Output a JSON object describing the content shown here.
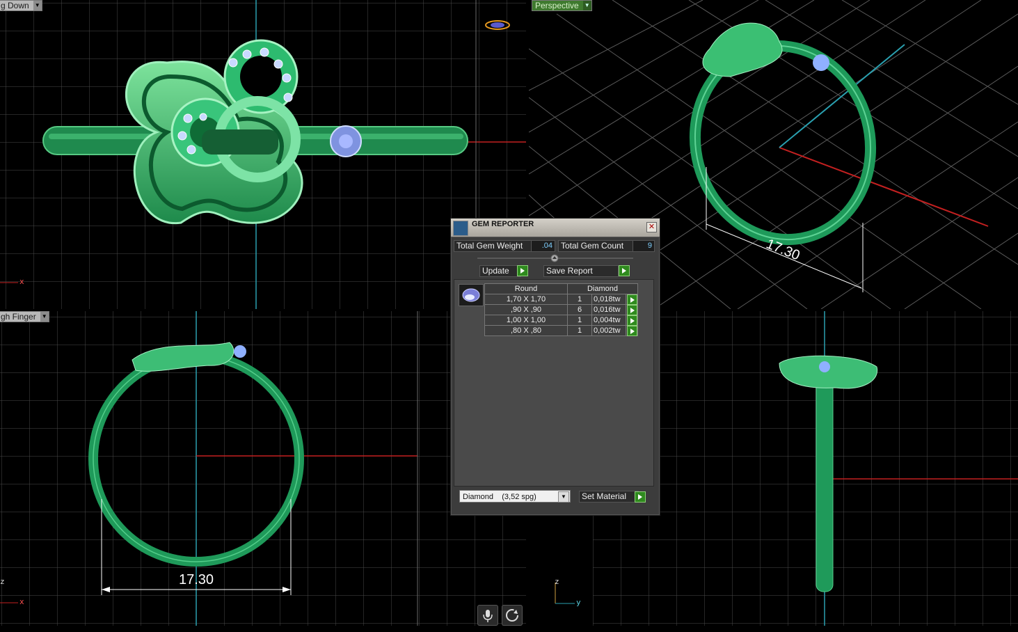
{
  "viewports": {
    "top_left": {
      "label": "g Down"
    },
    "top_right": {
      "label": "Perspective"
    },
    "bottom_left": {
      "label": "gh Finger"
    },
    "bottom_right": {
      "label": ""
    }
  },
  "dimensions": {
    "perspective": "17.30",
    "front": "17.30"
  },
  "axis_labels": {
    "x": "x",
    "y": "y",
    "z": "z"
  },
  "gem_reporter": {
    "title": "GEM REPORTER",
    "close_label": "✕",
    "total_gem_weight_label": "Total Gem Weight",
    "total_gem_weight_value": ".04",
    "total_gem_count_label": "Total Gem Count",
    "total_gem_count_value": "9",
    "update_label": "Update",
    "save_report_label": "Save Report",
    "table": {
      "headers": [
        "Round",
        "Diamond"
      ],
      "rows": [
        {
          "size": "1,70 X 1,70",
          "count": "1",
          "weight": "0,018tw"
        },
        {
          "size": ",90 X ,90",
          "count": "6",
          "weight": "0,016tw"
        },
        {
          "size": "1,00 X 1,00",
          "count": "1",
          "weight": "0,004tw"
        },
        {
          "size": ",80 X ,80",
          "count": "1",
          "weight": "0,002tw"
        }
      ]
    },
    "material_value": "Diamond    (3,52 spg)",
    "set_material_label": "Set Material"
  },
  "bottom_buttons": [
    "microphone-icon",
    "refresh-icon"
  ]
}
